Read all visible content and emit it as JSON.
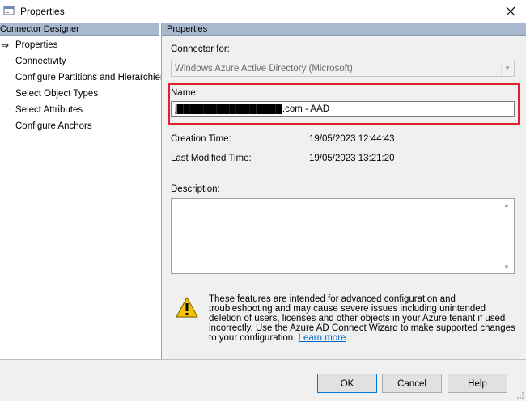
{
  "window": {
    "title": "Properties",
    "close_glyph": "✕"
  },
  "left_panel": {
    "header": "Connector Designer",
    "current_arrow": "⇒",
    "items": [
      {
        "label": "Properties",
        "selected": true
      },
      {
        "label": "Connectivity"
      },
      {
        "label": "Configure Partitions and Hierarchies"
      },
      {
        "label": "Select Object Types"
      },
      {
        "label": "Select Attributes"
      },
      {
        "label": "Configure Anchors"
      }
    ]
  },
  "right_panel": {
    "header": "Properties",
    "connector_for_label": "Connector for:",
    "connector_for_value": "Windows Azure Active Directory (Microsoft)",
    "name_label": "Name:",
    "name_value": "j████████████████.com - AAD",
    "creation_time_label": "Creation Time:",
    "creation_time_value": "19/05/2023 12:44:43",
    "last_modified_label": "Last Modified Time:",
    "last_modified_value": "19/05/2023 13:21:20",
    "description_label": "Description:",
    "description_value": "",
    "warning_text": "These features are intended for advanced configuration and troubleshooting and may cause severe issues including unintended deletion of users, licenses and other objects in your Azure tenant if used incorrectly. Use the Azure AD Connect Wizard to make supported changes to your configuration.",
    "learn_more": "Learn more",
    "warning_end": "."
  },
  "buttons": {
    "ok": "OK",
    "cancel": "Cancel",
    "help": "Help"
  },
  "colors": {
    "panel_header": "#a7b8cf",
    "highlight": "#e0202a",
    "link": "#0066cc"
  }
}
